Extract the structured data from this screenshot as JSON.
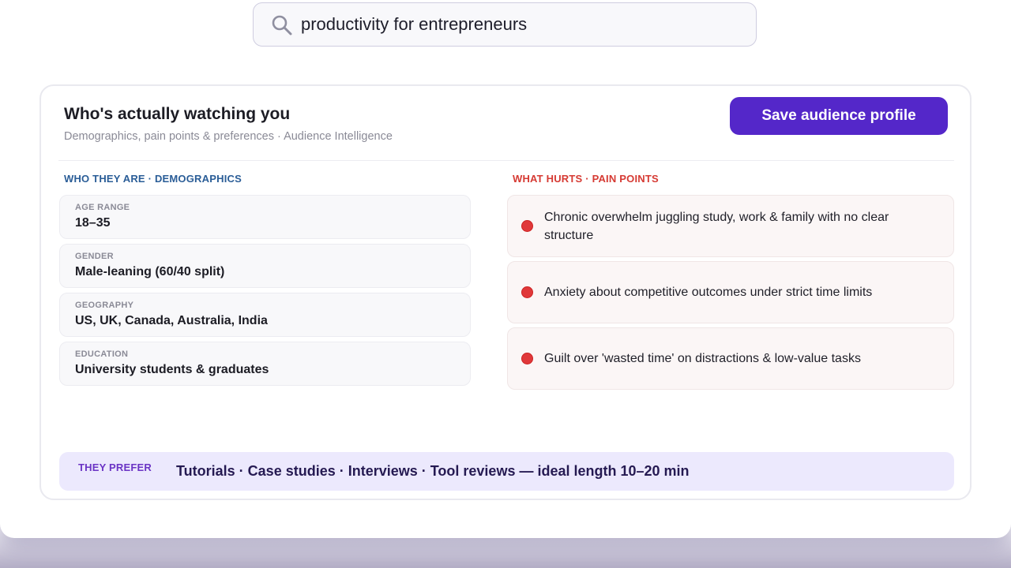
{
  "search": {
    "value": "productivity for entrepreneurs",
    "icon": "search-icon"
  },
  "card": {
    "title": "Who's actually watching you",
    "subtitle": "Demographics, pain points & preferences · Audience Intelligence",
    "save_label": "Save audience profile"
  },
  "demographics": {
    "heading": "WHO THEY ARE · DEMOGRAPHICS",
    "items": [
      {
        "label": "AGE RANGE",
        "value": "18–35"
      },
      {
        "label": "GENDER",
        "value": "Male-leaning (60/40 split)"
      },
      {
        "label": "GEOGRAPHY",
        "value": "US, UK, Canada, Australia, India"
      },
      {
        "label": "EDUCATION",
        "value": "University students & graduates"
      }
    ]
  },
  "pain_points": {
    "heading": "WHAT HURTS · PAIN POINTS",
    "items": [
      {
        "text": "Chronic overwhelm juggling study, work & family with no clear structure"
      },
      {
        "text": "Anxiety about competitive outcomes under strict time limits"
      },
      {
        "text": "Guilt over 'wasted time' on distractions & low-value tasks"
      }
    ]
  },
  "preferences": {
    "label": "THEY PREFER",
    "value": "Tutorials · Case studies · Interviews · Tool reviews — ideal length 10–20 min"
  },
  "colors": {
    "accent": "#5427c9",
    "demographics_heading": "#2a5d97",
    "pain_heading": "#d63a33",
    "pain_dot": "#e0383a",
    "prefer_bg": "#ece9fd"
  }
}
